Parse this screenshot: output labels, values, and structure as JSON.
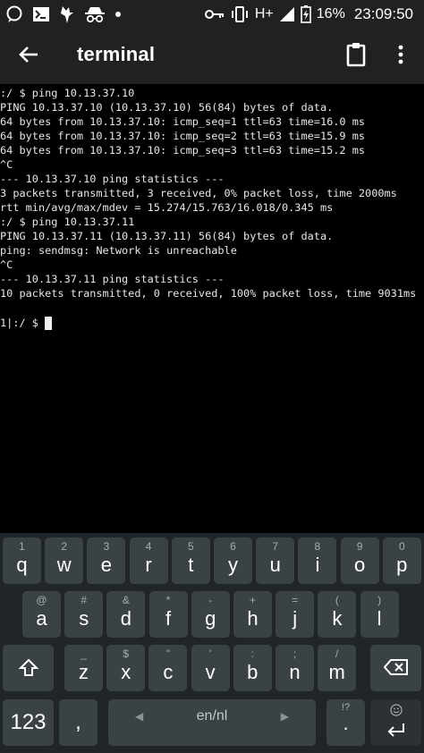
{
  "status_bar": {
    "battery_text": "16%",
    "time": "23:09:50",
    "network_text": "H+"
  },
  "app_bar": {
    "title": "terminal"
  },
  "terminal": {
    "lines": [
      ":/ $ ping 10.13.37.10",
      "PING 10.13.37.10 (10.13.37.10) 56(84) bytes of data.",
      "64 bytes from 10.13.37.10: icmp_seq=1 ttl=63 time=16.0 ms",
      "64 bytes from 10.13.37.10: icmp_seq=2 ttl=63 time=15.9 ms",
      "64 bytes from 10.13.37.10: icmp_seq=3 ttl=63 time=15.2 ms",
      "^C",
      "--- 10.13.37.10 ping statistics ---",
      "3 packets transmitted, 3 received, 0% packet loss, time 2000ms",
      "rtt min/avg/max/mdev = 15.274/15.763/16.018/0.345 ms",
      ":/ $ ping 10.13.37.11",
      "PING 10.13.37.11 (10.13.37.11) 56(84) bytes of data.",
      "ping: sendmsg: Network is unreachable",
      "^C",
      "--- 10.13.37.11 ping statistics ---",
      "10 packets transmitted, 0 received, 100% packet loss, time 9031ms",
      ""
    ],
    "prompt": "1|:/ $ "
  },
  "keyboard": {
    "row1": [
      {
        "main": "q",
        "hint": "1"
      },
      {
        "main": "w",
        "hint": "2"
      },
      {
        "main": "e",
        "hint": "3"
      },
      {
        "main": "r",
        "hint": "4"
      },
      {
        "main": "t",
        "hint": "5"
      },
      {
        "main": "y",
        "hint": "6"
      },
      {
        "main": "u",
        "hint": "7"
      },
      {
        "main": "i",
        "hint": "8"
      },
      {
        "main": "o",
        "hint": "9"
      },
      {
        "main": "p",
        "hint": "0"
      }
    ],
    "row2": [
      {
        "main": "a",
        "hint": "@"
      },
      {
        "main": "s",
        "hint": "#"
      },
      {
        "main": "d",
        "hint": "&"
      },
      {
        "main": "f",
        "hint": "*"
      },
      {
        "main": "g",
        "hint": "-"
      },
      {
        "main": "h",
        "hint": "+"
      },
      {
        "main": "j",
        "hint": "="
      },
      {
        "main": "k",
        "hint": "("
      },
      {
        "main": "l",
        "hint": ")"
      }
    ],
    "row3": [
      {
        "main": "z",
        "hint": "_"
      },
      {
        "main": "x",
        "hint": "$"
      },
      {
        "main": "c",
        "hint": "\""
      },
      {
        "main": "v",
        "hint": "'"
      },
      {
        "main": "b",
        "hint": ":"
      },
      {
        "main": "n",
        "hint": ";"
      },
      {
        "main": "m",
        "hint": "/"
      }
    ],
    "symbols_label": "123",
    "comma_label": ",",
    "space_label": "en/nl",
    "period_label": ".",
    "period_hint": "!?",
    "shift_icon": "shift-icon",
    "backspace_icon": "backspace-icon",
    "enter_icon": "enter-icon"
  }
}
